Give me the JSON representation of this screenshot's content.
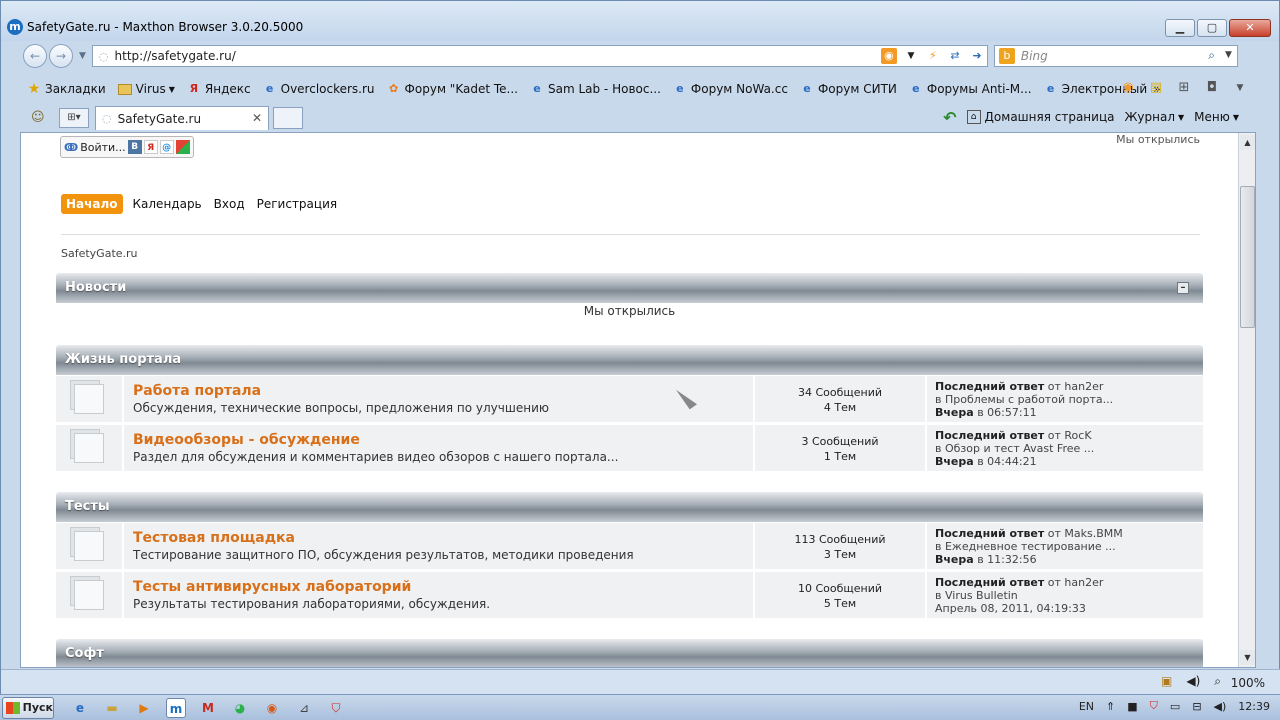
{
  "browser": {
    "title": "SafetyGate.ru - Maxthon Browser 3.0.20.5000",
    "url": "http://safetygate.ru/",
    "search_placeholder": "Bing",
    "bookmarks": [
      "Закладки",
      "Virus",
      "Яндекс",
      "Overclockers.ru",
      "Форум \"Kadet Te...",
      "Sam Lab - Новос...",
      "Форум NoWa.cc",
      "Форум СИТИ",
      "Форумы Anti-M...",
      "Электронный"
    ],
    "tab_title": "SafetyGate.ru",
    "home_label": "Домашняя страница",
    "journal_label": "Журнал",
    "menu_label": "Меню",
    "zoom": "100%"
  },
  "page": {
    "login_label": "Войти...",
    "top_text": "Мы открылись",
    "menu": [
      "Начало",
      "Календарь",
      "Вход",
      "Регистрация"
    ],
    "breadcrumb": "SafetyGate.ru",
    "news": {
      "title": "Новости",
      "text": "Мы открылись"
    },
    "categories": [
      {
        "title": "Жизнь портала",
        "forums": [
          {
            "title": "Работа портала",
            "desc": "Обсуждения, технические вопросы, предложения по улучшению",
            "posts": "34 Сообщений",
            "topics": "4 Тем",
            "last_label": "Последний ответ",
            "last_by": "от han2er",
            "last_in": "в Проблемы с работой порта...",
            "last_day": "Вчера",
            "last_time": "в 06:57:11"
          },
          {
            "title": "Видеообзоры - обсуждение",
            "desc": "Раздел для обсуждения и комментариев видео обзоров с нашего портала...",
            "posts": "3 Сообщений",
            "topics": "1 Тем",
            "last_label": "Последний ответ",
            "last_by": "от RocK",
            "last_in": "в Обзор и тест Avast Free ...",
            "last_day": "Вчера",
            "last_time": "в 04:44:21"
          }
        ]
      },
      {
        "title": "Тесты",
        "forums": [
          {
            "title": "Тестовая площадка",
            "desc": "Тестирование защитного ПО, обсуждения результатов, методики проведения",
            "posts": "113 Сообщений",
            "topics": "3 Тем",
            "last_label": "Последний ответ",
            "last_by": "от Maks.BMM",
            "last_in": "в Ежедневное тестирование ...",
            "last_day": "Вчера",
            "last_time": "в 11:32:56"
          },
          {
            "title": "Тесты антивирусных лабораторий",
            "desc": "Результаты тестирования лабораториями, обсуждения.",
            "posts": "10 Сообщений",
            "topics": "5 Тем",
            "last_label": "Последний ответ",
            "last_by": "от han2er",
            "last_in": "в Virus Bulletin",
            "last_day": "",
            "last_time": "Апрель 08, 2011, 04:19:33"
          }
        ]
      },
      {
        "title": "Софт",
        "forums": []
      }
    ]
  },
  "taskbar": {
    "start_label": "Пуск",
    "lang": "EN",
    "clock": "12:39"
  }
}
